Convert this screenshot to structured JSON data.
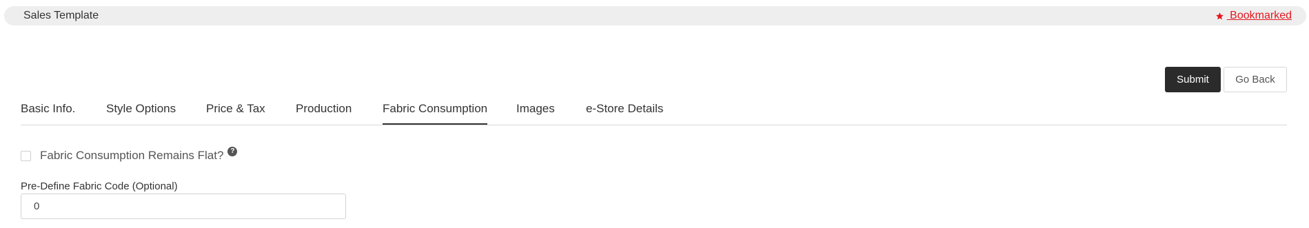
{
  "header": {
    "title": "Sales Template",
    "bookmark_label": " Bookmarked",
    "bookmark_color": "#e4171f"
  },
  "actions": {
    "submit_label": "Submit",
    "back_label": "Go Back"
  },
  "tabs": [
    {
      "label": "Basic Info.",
      "active": false
    },
    {
      "label": "Style Options",
      "active": false
    },
    {
      "label": "Price & Tax",
      "active": false
    },
    {
      "label": "Production",
      "active": false
    },
    {
      "label": "Fabric Consumption",
      "active": true
    },
    {
      "label": "Images",
      "active": false
    },
    {
      "label": "e-Store Details",
      "active": false
    }
  ],
  "form": {
    "flat_checkbox_label": "Fabric Consumption Remains Flat?",
    "flat_checkbox_checked": false,
    "help_icon": "question-circle-icon",
    "help_glyph": "?",
    "fabric_code_label": "Pre-Define Fabric Code (Optional)",
    "fabric_code_value": "0"
  }
}
